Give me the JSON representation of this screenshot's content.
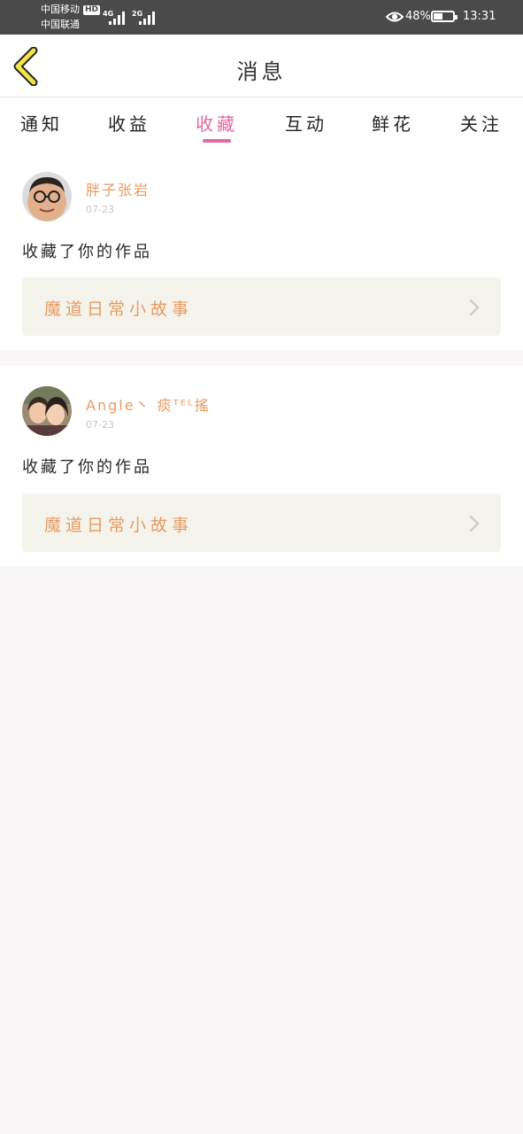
{
  "status_bar": {
    "carrier_1": "中国移动",
    "carrier_1_badge": "HD",
    "carrier_2": "中国联通",
    "network_1": "4G",
    "network_2": "2G",
    "battery_percent_text": "48%",
    "battery_level": 0.48,
    "time": "13:31",
    "icons": [
      "signal-bars-icon",
      "eye-comfort-icon",
      "battery-icon"
    ]
  },
  "header": {
    "back_icon": "chevron-left-icon",
    "title": "消息"
  },
  "tabs": {
    "items": [
      {
        "label": "通知"
      },
      {
        "label": "收益"
      },
      {
        "label": "收藏"
      },
      {
        "label": "互动"
      },
      {
        "label": "鲜花"
      },
      {
        "label": "关注"
      }
    ],
    "active_index": 2
  },
  "messages": [
    {
      "username": "胖子张岩",
      "date": "07-23",
      "action": "收藏了你的作品",
      "work_title": "魔道日常小故事",
      "avatar_icon": "avatar-icon"
    },
    {
      "username": "Angle丶 痰ᵀᴱᴸ搖",
      "date": "07-23",
      "action": "收藏了你的作品",
      "work_title": "魔道日常小故事",
      "avatar_icon": "avatar-icon"
    }
  ],
  "colors": {
    "accent_pink": "#e06aa0",
    "username_orange": "#e79b63",
    "back_arrow_yellow": "#f2e44a",
    "work_box_bg": "#f4f4ec"
  }
}
